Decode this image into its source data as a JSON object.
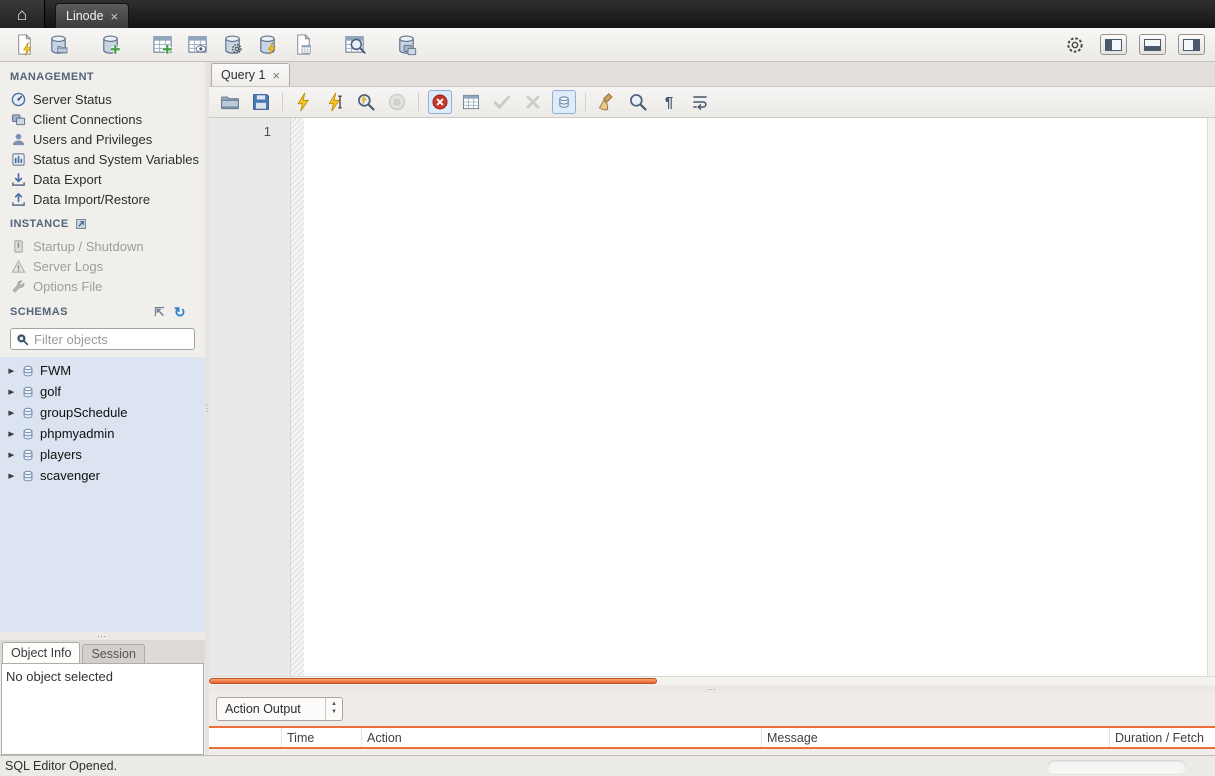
{
  "colors": {
    "accent_orange": "#ed6f39",
    "schema_panel_blue": "#dbe4f0",
    "titlebar_bg": "#1f1f1f",
    "toolbar_bg": "#f1efec"
  },
  "icons": {
    "home": "⌂",
    "close": "×",
    "expander": "▶",
    "refresh": "↻",
    "expand": "⇱",
    "pilcrow": "¶",
    "dots_h": "⋯",
    "dots_v": "⋮",
    "spin_up": "▲",
    "spin_down": "▼"
  },
  "titlebar": {
    "tab": {
      "label": "Linode"
    }
  },
  "sidebar": {
    "management": {
      "title": "MANAGEMENT",
      "items": [
        {
          "label": "Server Status"
        },
        {
          "label": "Client Connections"
        },
        {
          "label": "Users and Privileges"
        },
        {
          "label": "Status and System Variables"
        },
        {
          "label": "Data Export"
        },
        {
          "label": "Data Import/Restore"
        }
      ]
    },
    "instance": {
      "title": "INSTANCE",
      "items": [
        {
          "label": "Startup / Shutdown"
        },
        {
          "label": "Server Logs"
        },
        {
          "label": "Options File"
        }
      ]
    },
    "schemas": {
      "title": "SCHEMAS",
      "filter_placeholder": "Filter objects",
      "items": [
        {
          "label": "FWM"
        },
        {
          "label": "golf"
        },
        {
          "label": "groupSchedule"
        },
        {
          "label": "phpmyadmin"
        },
        {
          "label": "players"
        },
        {
          "label": "scavenger"
        }
      ]
    },
    "info_panel": {
      "tabs": [
        {
          "label": "Object Info"
        },
        {
          "label": "Session"
        }
      ],
      "message": "No object selected"
    }
  },
  "editor": {
    "tab": {
      "label": "Query 1"
    },
    "line_numbers": [
      "1"
    ]
  },
  "output": {
    "selector_value": "Action Output",
    "columns": [
      "",
      "Time",
      "Action",
      "Message",
      "Duration / Fetch"
    ]
  },
  "statusbar": {
    "message": "SQL Editor Opened."
  }
}
